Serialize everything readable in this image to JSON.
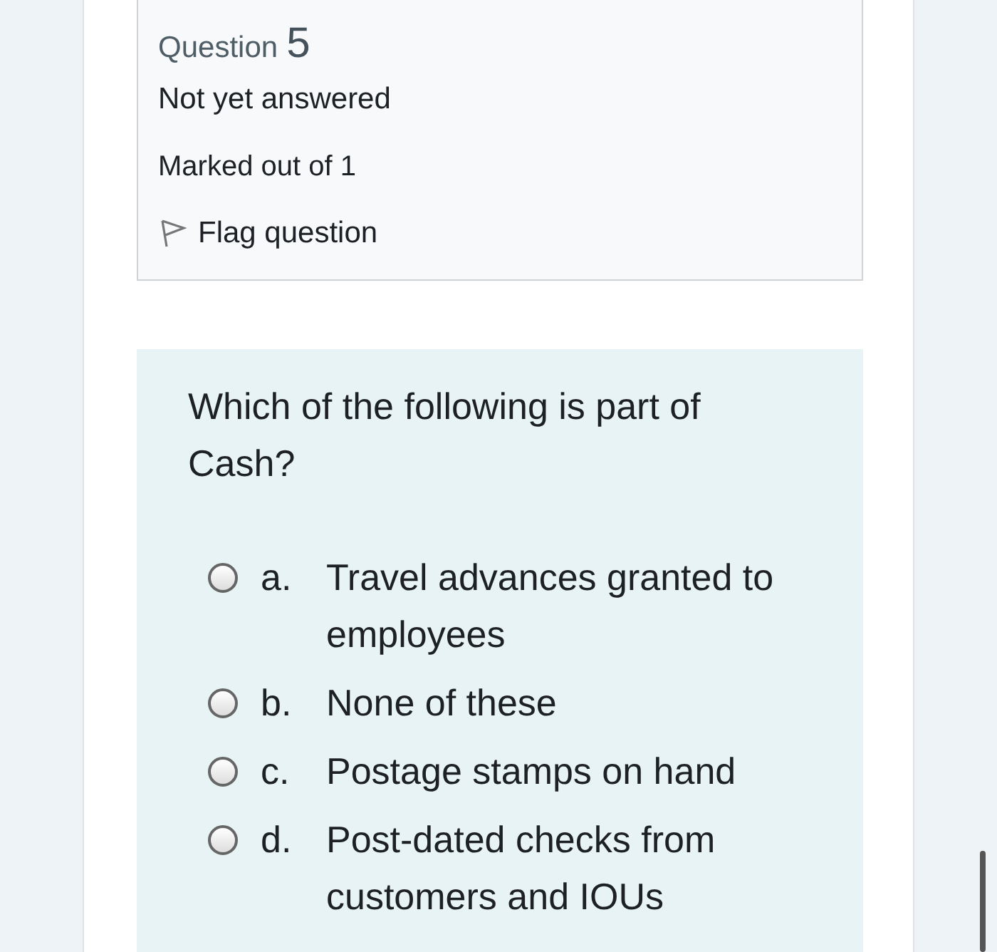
{
  "info": {
    "label": "Question",
    "number": "5",
    "state": "Not yet answered",
    "marks": "Marked out of 1",
    "flag": {
      "label": "Flag question",
      "flagged": false
    }
  },
  "question": {
    "text": "Which of the following is part of Cash?",
    "options": [
      {
        "letter": "a.",
        "text": "Travel advances granted to employees",
        "selected": false
      },
      {
        "letter": "b.",
        "text": "None of these",
        "selected": false
      },
      {
        "letter": "c.",
        "text": "Postage stamps on hand",
        "selected": false
      },
      {
        "letter": "d.",
        "text": "Post-dated checks from customers and IOUs",
        "selected": false
      }
    ]
  }
}
